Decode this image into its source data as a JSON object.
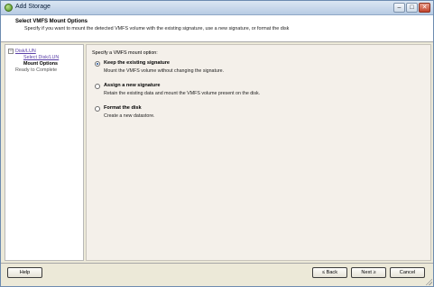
{
  "window": {
    "title": "Add Storage",
    "buttons": {
      "minimize": "–",
      "maximize": "□",
      "close": "✕"
    }
  },
  "header": {
    "title": "Select VMFS Mount Options",
    "description": "Specify if you want to mount the detected VMFS volume with the existing signature, use a new signature, or format the disk"
  },
  "sidebar": {
    "toggle": "−",
    "items": [
      {
        "label": "Disk/LUN",
        "state": "link"
      },
      {
        "label": "Select Disk/LUN",
        "state": "link"
      },
      {
        "label": "Mount Options",
        "state": "current"
      },
      {
        "label": "Ready to Complete",
        "state": "disabled"
      }
    ]
  },
  "content": {
    "prompt": "Specify a VMFS mount option:",
    "options": [
      {
        "title": "Keep the existing signature",
        "description": "Mount the VMFS volume without changing the signature.",
        "selected": true
      },
      {
        "title": "Assign a new signature",
        "description": "Retain the existing data and mount the VMFS volume present on the disk.",
        "selected": false
      },
      {
        "title": "Format the disk",
        "description": "Create a new datastore.",
        "selected": false
      }
    ]
  },
  "footer": {
    "help": "Help",
    "back": "≤ Back",
    "next": "Next ≥",
    "cancel": "Cancel"
  }
}
